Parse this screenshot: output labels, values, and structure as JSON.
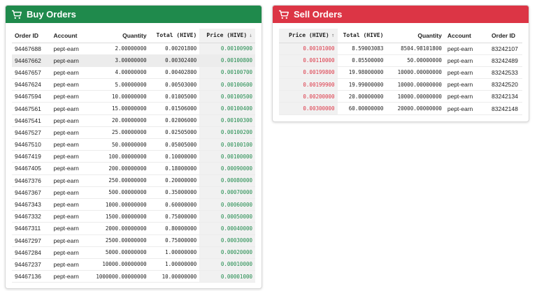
{
  "colors": {
    "buy": "#1f8a4c",
    "sell": "#dc3545"
  },
  "buy": {
    "title": "Buy Orders",
    "icon": "shopping-cart-icon",
    "columns": {
      "order_id": "Order ID",
      "account": "Account",
      "quantity": "Quantity",
      "total": "Total (HIVE)",
      "price": "Price (HIVE)",
      "price_sort": "↓"
    },
    "rows": [
      {
        "order_id": "94467688",
        "account": "pept-earn",
        "quantity": "2.00000000",
        "total": "0.00201800",
        "price": "0.00100900"
      },
      {
        "order_id": "94467662",
        "account": "pept-earn",
        "quantity": "3.00000000",
        "total": "0.00302400",
        "price": "0.00100800"
      },
      {
        "order_id": "94467657",
        "account": "pept-earn",
        "quantity": "4.00000000",
        "total": "0.00402800",
        "price": "0.00100700"
      },
      {
        "order_id": "94467624",
        "account": "pept-earn",
        "quantity": "5.00000000",
        "total": "0.00503000",
        "price": "0.00100600"
      },
      {
        "order_id": "94467594",
        "account": "pept-earn",
        "quantity": "10.00000000",
        "total": "0.01005000",
        "price": "0.00100500"
      },
      {
        "order_id": "94467561",
        "account": "pept-earn",
        "quantity": "15.00000000",
        "total": "0.01506000",
        "price": "0.00100400"
      },
      {
        "order_id": "94467541",
        "account": "pept-earn",
        "quantity": "20.00000000",
        "total": "0.02006000",
        "price": "0.00100300"
      },
      {
        "order_id": "94467527",
        "account": "pept-earn",
        "quantity": "25.00000000",
        "total": "0.02505000",
        "price": "0.00100200"
      },
      {
        "order_id": "94467510",
        "account": "pept-earn",
        "quantity": "50.00000000",
        "total": "0.05005000",
        "price": "0.00100100"
      },
      {
        "order_id": "94467419",
        "account": "pept-earn",
        "quantity": "100.00000000",
        "total": "0.10000000",
        "price": "0.00100000"
      },
      {
        "order_id": "94467405",
        "account": "pept-earn",
        "quantity": "200.00000000",
        "total": "0.18000000",
        "price": "0.00090000"
      },
      {
        "order_id": "94467376",
        "account": "pept-earn",
        "quantity": "250.00000000",
        "total": "0.20000000",
        "price": "0.00080000"
      },
      {
        "order_id": "94467367",
        "account": "pept-earn",
        "quantity": "500.00000000",
        "total": "0.35000000",
        "price": "0.00070000"
      },
      {
        "order_id": "94467343",
        "account": "pept-earn",
        "quantity": "1000.00000000",
        "total": "0.60000000",
        "price": "0.00060000"
      },
      {
        "order_id": "94467332",
        "account": "pept-earn",
        "quantity": "1500.00000000",
        "total": "0.75000000",
        "price": "0.00050000"
      },
      {
        "order_id": "94467311",
        "account": "pept-earn",
        "quantity": "2000.00000000",
        "total": "0.80000000",
        "price": "0.00040000"
      },
      {
        "order_id": "94467297",
        "account": "pept-earn",
        "quantity": "2500.00000000",
        "total": "0.75000000",
        "price": "0.00030000"
      },
      {
        "order_id": "94467284",
        "account": "pept-earn",
        "quantity": "5000.00000000",
        "total": "1.00000000",
        "price": "0.00020000"
      },
      {
        "order_id": "94467237",
        "account": "pept-earn",
        "quantity": "10000.00000000",
        "total": "1.00000000",
        "price": "0.00010000"
      },
      {
        "order_id": "94467136",
        "account": "pept-earn",
        "quantity": "1000000.00000000",
        "total": "10.00000000",
        "price": "0.00001000"
      }
    ]
  },
  "sell": {
    "title": "Sell Orders",
    "icon": "shopping-cart-icon",
    "columns": {
      "price": "Price (HIVE)",
      "price_sort": "↑",
      "total": "Total (HIVE)",
      "quantity": "Quantity",
      "account": "Account",
      "order_id": "Order ID"
    },
    "rows": [
      {
        "price": "0.00101000",
        "total": "8.59003083",
        "quantity": "8504.98101800",
        "account": "pept-earn",
        "order_id": "83242107"
      },
      {
        "price": "0.00110000",
        "total": "0.05500000",
        "quantity": "50.00000000",
        "account": "pept-earn",
        "order_id": "83242489"
      },
      {
        "price": "0.00199800",
        "total": "19.98000000",
        "quantity": "10000.00000000",
        "account": "pept-earn",
        "order_id": "83242533"
      },
      {
        "price": "0.00199900",
        "total": "19.99000000",
        "quantity": "10000.00000000",
        "account": "pept-earn",
        "order_id": "83242520"
      },
      {
        "price": "0.00200000",
        "total": "20.00000000",
        "quantity": "10000.00000000",
        "account": "pept-earn",
        "order_id": "83242134"
      },
      {
        "price": "0.00300000",
        "total": "60.00000000",
        "quantity": "20000.00000000",
        "account": "pept-earn",
        "order_id": "83242148"
      }
    ]
  }
}
